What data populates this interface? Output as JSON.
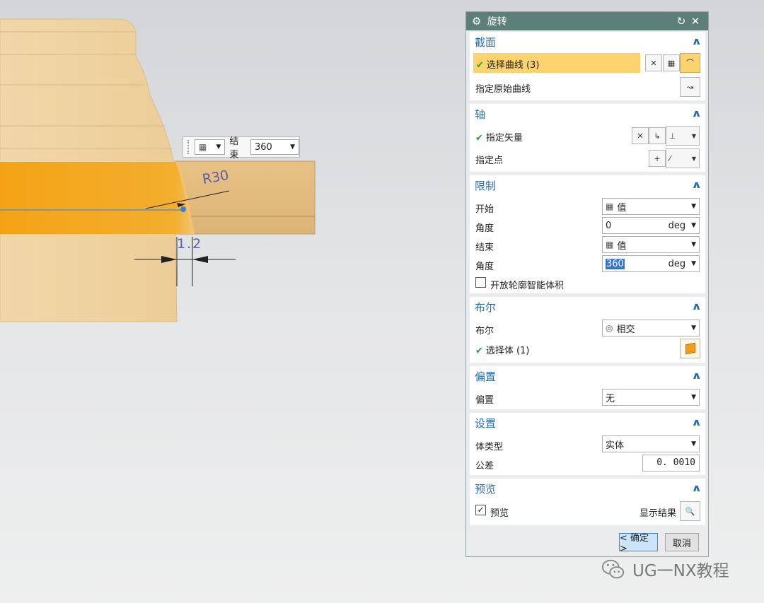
{
  "viewport": {
    "mini_toolbar": {
      "end_label": "结束",
      "end_value": "360"
    },
    "annotations": {
      "radius": "R30",
      "dimension": "1.2"
    }
  },
  "dialog": {
    "title": "旋转",
    "section": {
      "header": "截面",
      "select_curve": "选择曲线 (3)",
      "specify_original_curve": "指定原始曲线"
    },
    "axis": {
      "header": "轴",
      "specify_vector": "指定矢量",
      "specify_point": "指定点"
    },
    "limits": {
      "header": "限制",
      "start_label": "开始",
      "start_type": "值",
      "start_angle_label": "角度",
      "start_angle": "0",
      "start_unit": "deg",
      "end_label": "结束",
      "end_type": "值",
      "end_angle_label": "角度",
      "end_angle": "360",
      "end_unit": "deg",
      "open_profile_label": "开放轮廓智能体积",
      "open_profile_checked": false
    },
    "boolean": {
      "header": "布尔",
      "label": "布尔",
      "value": "相交",
      "select_body": "选择体 (1)"
    },
    "offset": {
      "header": "偏置",
      "label": "偏置",
      "value": "无"
    },
    "settings": {
      "header": "设置",
      "body_type_label": "体类型",
      "body_type": "实体",
      "tolerance_label": "公差",
      "tolerance": "0. 0010"
    },
    "preview": {
      "header": "预览",
      "preview_label": "预览",
      "preview_checked": true,
      "show_result": "显示结果"
    },
    "buttons": {
      "ok": "< 确定 >",
      "cancel": "取消"
    }
  },
  "watermark": "UG一NX教程",
  "colors": {
    "title_bar": "#5d7f7a",
    "section_header": "#2b6cab",
    "highlight": "#fcd36f",
    "model_orange": "#f0a420"
  }
}
